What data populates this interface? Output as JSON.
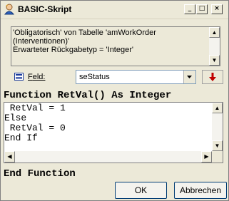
{
  "window": {
    "title": "BASIC-Skript"
  },
  "titlebar": {
    "minimize_glyph": "_",
    "maximize_glyph": "□",
    "close_glyph": "×"
  },
  "message": {
    "text": "'Obligatorisch' von Tabelle 'amWorkOrder\n(Interventionen)'\nErwarteter Rückgabetyp = 'Integer'"
  },
  "field": {
    "label_accel": "F",
    "label_rest": "eld:",
    "selected_value": "seStatus"
  },
  "code": {
    "header": "Function RetVal() As Integer",
    "body": " RetVal = 1\nElse\n RetVal = 0\nEnd If",
    "footer": "End Function"
  },
  "buttons": {
    "ok_label": "OK",
    "cancel_label": "Abbrechen"
  },
  "colors": {
    "dialog_bg": "#ece9d8",
    "insert_arrow": "#c00000",
    "icon_blue": "#1c3c9c"
  },
  "icons": {
    "app": "wizard-app-icon",
    "field": "field-list-icon",
    "insert": "insert-field-arrow-icon"
  }
}
